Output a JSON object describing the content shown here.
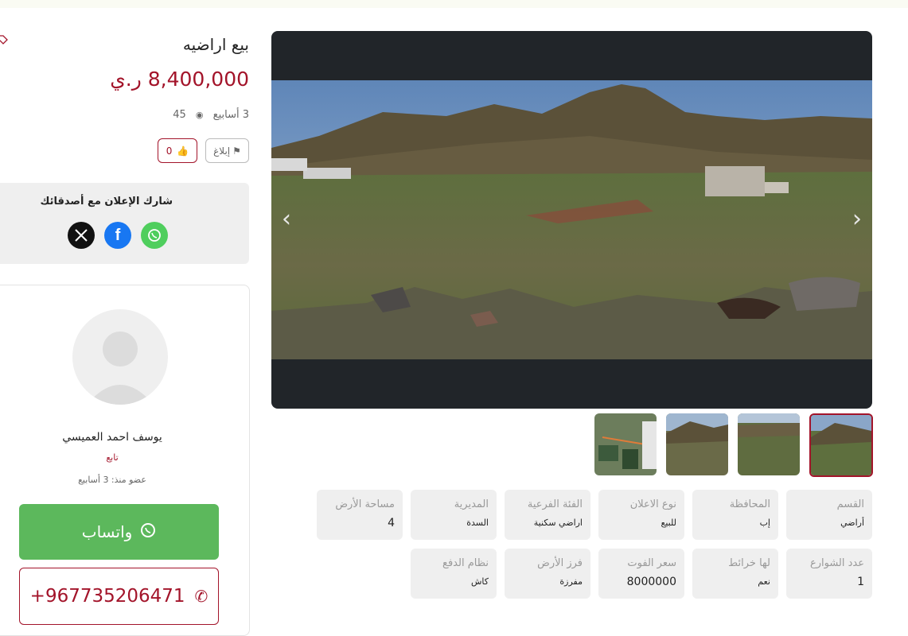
{
  "listing": {
    "title": "بيع اراضيه",
    "price": "8,400,000 ر.ي",
    "age": "3 أسابيع",
    "views": "45",
    "report_label": "إبلاغ",
    "likes": "0"
  },
  "share": {
    "title": "شارك الإعلان مع أصدقائك",
    "networks": [
      "x-icon",
      "facebook-icon",
      "whatsapp-icon"
    ]
  },
  "seller": {
    "name": "يوسف احمد العميسي",
    "follow_label": "تابع",
    "member_since": "عضو منذ: 3 أسابيع",
    "whatsapp_label": "واتساب",
    "phone": "+967735206471"
  },
  "details_row1": [
    {
      "label": "القسم",
      "value": "أراضي"
    },
    {
      "label": "المحافظة",
      "value": "إب"
    },
    {
      "label": "نوع الاعلان",
      "value": "للبيع"
    },
    {
      "label": "الفئة الفرعية",
      "value": "اراضي سكنية"
    },
    {
      "label": "المديرية",
      "value": "السدة"
    },
    {
      "label": "مساحة الأرض",
      "value": "4"
    }
  ],
  "details_row2": [
    {
      "label": "عدد الشوارع",
      "value": "1"
    },
    {
      "label": "لها خرائط",
      "value": "نعم"
    },
    {
      "label": "سعر الفوت",
      "value": "8000000"
    },
    {
      "label": "فرز الأرض",
      "value": "مفرزة"
    },
    {
      "label": "نظام الدفع",
      "value": "كاش"
    }
  ],
  "colors": {
    "accent": "#a3142a",
    "whatsapp": "#5cb85c",
    "gallery_bg": "#212529"
  }
}
